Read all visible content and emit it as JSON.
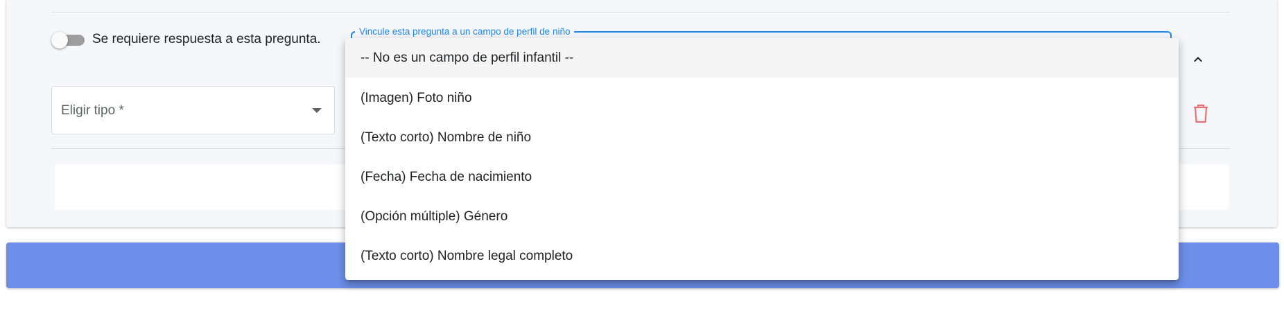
{
  "question": {
    "required_toggle": {
      "label": "Se requiere respuesta a esta pregunta.",
      "on": false
    },
    "link_field": {
      "label": "Vincule esta pregunta a un campo de perfil de niño"
    },
    "type_select": {
      "placeholder": "Eligir tipo *"
    }
  },
  "icons": {
    "collapse": "chevron-up-icon",
    "delete": "trash-icon",
    "type_dropdown": "arrow-drop-down-icon"
  },
  "colors": {
    "accent": "#1e88e5",
    "button": "#6d8fea",
    "delete": "#e57373",
    "card": "#f6f7fb"
  },
  "menu": {
    "items": [
      {
        "label": "-- No es un campo de perfil infantil --",
        "selected": true
      },
      {
        "label": "(Imagen) Foto niño",
        "selected": false
      },
      {
        "label": "(Texto corto) Nombre de niño",
        "selected": false
      },
      {
        "label": "(Fecha) Fecha de nacimiento",
        "selected": false
      },
      {
        "label": "(Opción múltiple) Género",
        "selected": false
      },
      {
        "label": "(Texto corto) Nombre legal completo",
        "selected": false
      }
    ]
  }
}
